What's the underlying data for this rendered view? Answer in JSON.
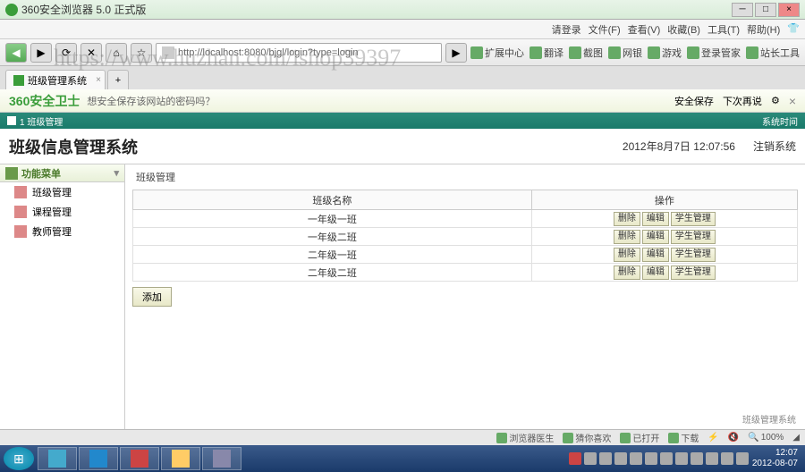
{
  "window": {
    "title": "360安全浏览器 5.0 正式版"
  },
  "menu": {
    "login": "请登录",
    "items": [
      "文件(F)",
      "查看(V)",
      "收藏(B)",
      "工具(T)",
      "帮助(H)"
    ]
  },
  "nav": {
    "url": "http://localhost:8080/bjgl/login?type=login",
    "tools": [
      "扩展中心",
      "翻译",
      "截图",
      "网银",
      "游戏",
      "登录管家",
      "站长工具"
    ]
  },
  "tabs": {
    "active": "班级管理系统"
  },
  "brand": {
    "logo": "360安全卫士",
    "msg": "想安全保存该网站的密码吗？",
    "save": "安全保存",
    "never": "下次再说"
  },
  "app_header": {
    "left": "1 班级管理",
    "right": "系统时间"
  },
  "page": {
    "title": "班级信息管理系统",
    "datetime": "2012年8月7日  12:07:56",
    "logout": "注销系统"
  },
  "sidebar": {
    "header": "功能菜单",
    "items": [
      "班级管理",
      "课程管理",
      "教师管理"
    ]
  },
  "main": {
    "tab": "班级管理",
    "columns": [
      "班级名称",
      "操作"
    ],
    "rows": [
      "一年级一班",
      "一年级二班",
      "二年级一班",
      "二年级二班"
    ],
    "ops": [
      "删除",
      "编辑",
      "学生管理"
    ],
    "add": "添加",
    "footer": "班级管理系统"
  },
  "status": {
    "items": [
      "浏览器医生",
      "猜你喜欢",
      "已打开",
      "下载",
      "加速器",
      "Q"
    ],
    "zoom": "100%"
  },
  "tray": {
    "time": "12:07",
    "date": "2012-08-07"
  },
  "watermark": "https://www.huzhan.com/ishop39397"
}
